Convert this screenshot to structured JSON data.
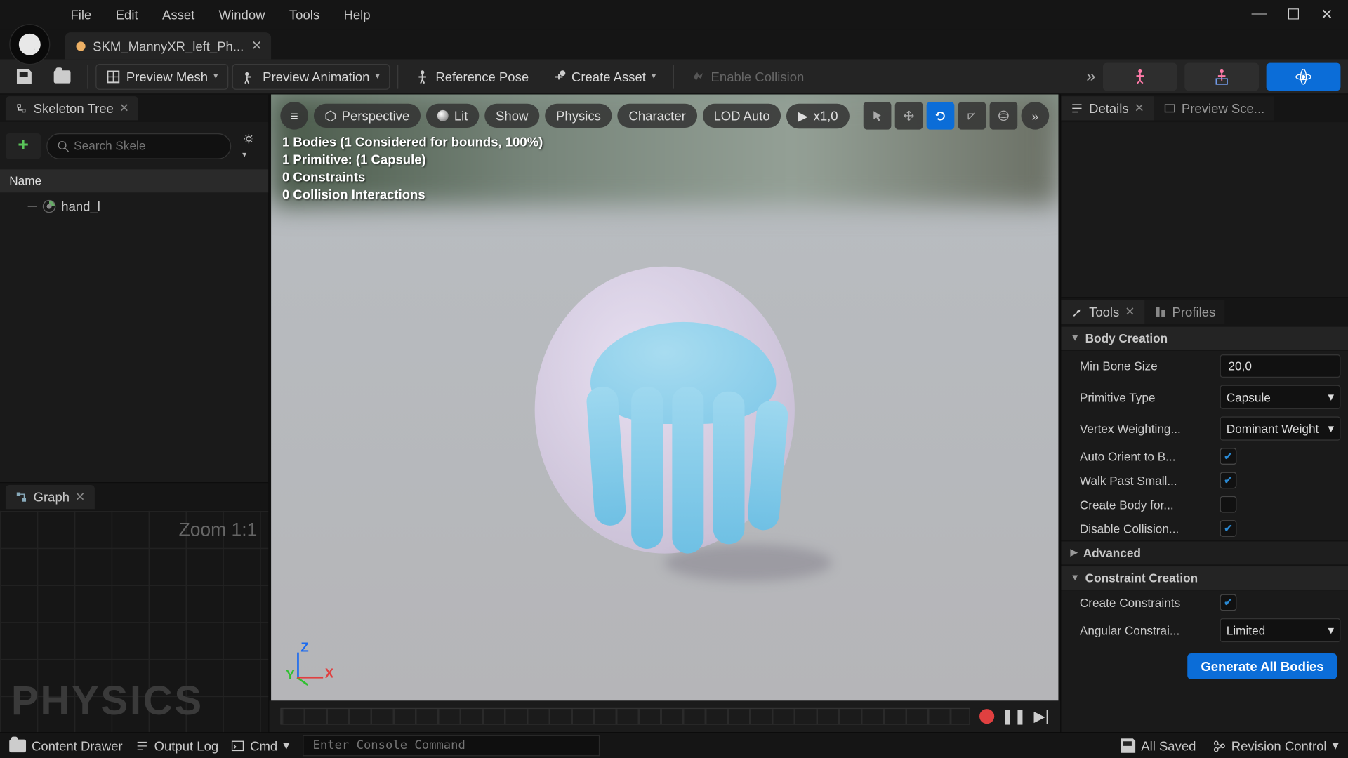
{
  "menu": [
    "File",
    "Edit",
    "Asset",
    "Window",
    "Tools",
    "Help"
  ],
  "document_tab": "SKM_MannyXR_left_Ph...",
  "toolbar": {
    "preview_mesh": "Preview Mesh",
    "preview_animation": "Preview Animation",
    "reference_pose": "Reference Pose",
    "create_asset": "Create Asset",
    "enable_collision": "Enable Collision"
  },
  "left_panel": {
    "title": "Skeleton Tree",
    "search_placeholder": "Search Skele",
    "name_header": "Name",
    "bone": "hand_l"
  },
  "graph_panel": {
    "title": "Graph",
    "zoom": "Zoom 1:1",
    "watermark": "PHYSICS"
  },
  "viewport": {
    "menu": "≡",
    "perspective": "Perspective",
    "lit": "Lit",
    "show": "Show",
    "physics": "Physics",
    "character": "Character",
    "lod": "LOD Auto",
    "speed": "x1,0",
    "stats": [
      "1 Bodies (1 Considered for bounds, 100%)",
      "1 Primitive: (1 Capsule)",
      "0 Constraints",
      "0 Collision Interactions"
    ],
    "axis": {
      "z": "Z",
      "x": "X",
      "y": "Y"
    }
  },
  "right_panels": {
    "details": "Details",
    "preview_scene": "Preview Sce...",
    "tools": "Tools",
    "profiles": "Profiles"
  },
  "body_creation": {
    "header": "Body Creation",
    "min_bone_size_label": "Min Bone Size",
    "min_bone_size": "20,0",
    "primitive_type_label": "Primitive Type",
    "primitive_type": "Capsule",
    "vertex_weighting_label": "Vertex Weighting...",
    "vertex_weighting": "Dominant Weight",
    "auto_orient_label": "Auto Orient to B...",
    "walk_past_label": "Walk Past Small...",
    "create_body_label": "Create Body for...",
    "disable_collision_label": "Disable Collision...",
    "advanced": "Advanced"
  },
  "constraint_creation": {
    "header": "Constraint Creation",
    "create_constraints_label": "Create Constraints",
    "angular_label": "Angular Constrai...",
    "angular": "Limited"
  },
  "generate_button": "Generate All Bodies",
  "status": {
    "content_drawer": "Content Drawer",
    "output_log": "Output Log",
    "cmd_label": "Cmd",
    "cmd_placeholder": "Enter Console Command",
    "all_saved": "All Saved",
    "revision": "Revision Control"
  }
}
